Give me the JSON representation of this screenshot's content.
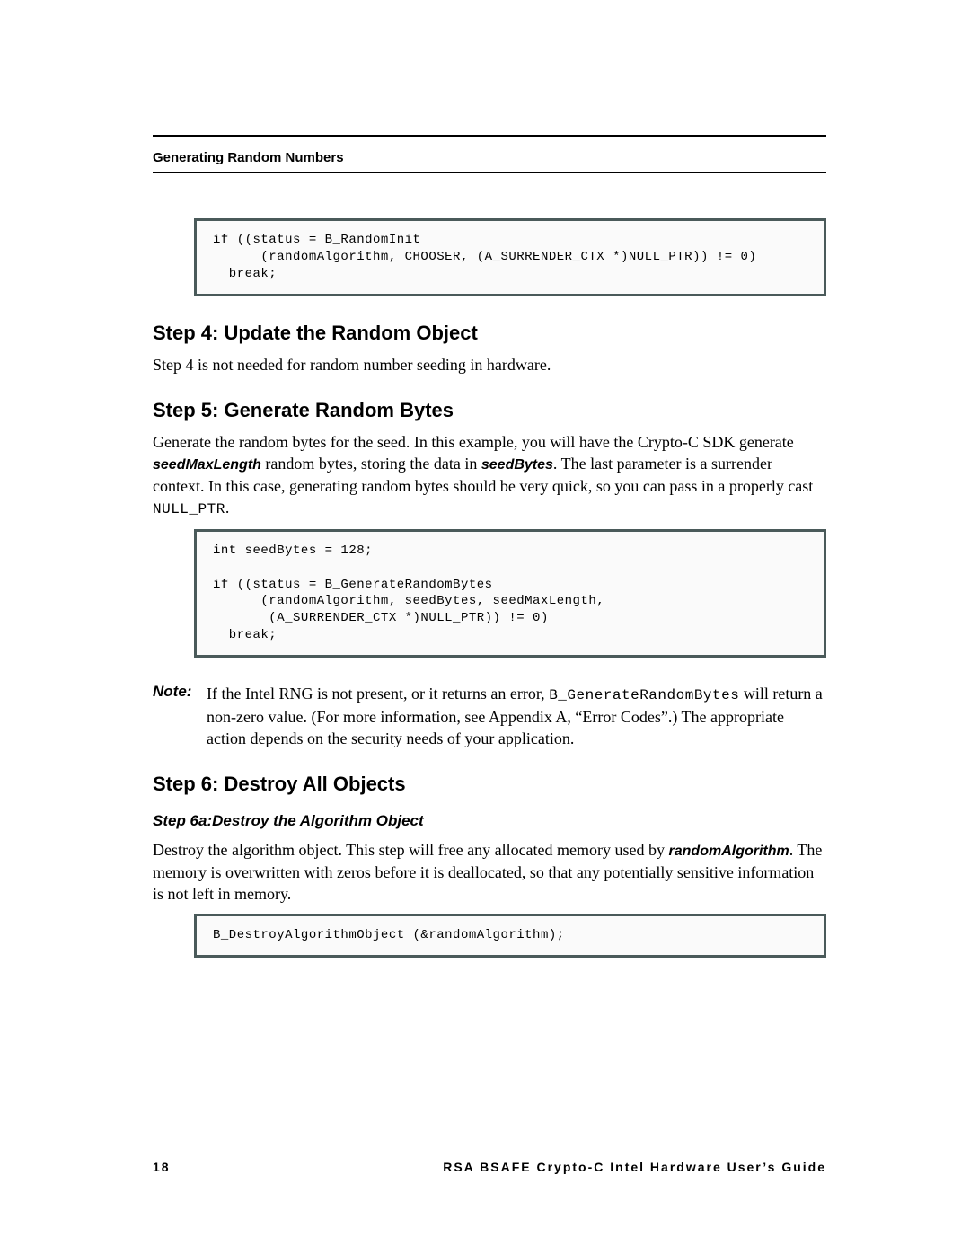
{
  "running_head": "Generating Random Numbers",
  "code1": "if ((status = B_RandomInit\n      (randomAlgorithm, CHOOSER, (A_SURRENDER_CTX *)NULL_PTR)) != 0)\n  break;",
  "step4": {
    "title": "Step 4: Update the Random Object",
    "para": "Step 4 is not needed for random number seeding in hardware."
  },
  "step5": {
    "title": "Step 5: Generate Random Bytes",
    "para_a": "Generate the random bytes for the seed. In this example, you will have the Crypto-C SDK generate ",
    "kw1": "seedMaxLength",
    "para_b": " random bytes, storing the data in ",
    "kw2": "seedBytes",
    "para_c": ". The last parameter is a surrender context. In this case, generating random bytes should be very quick, so you can pass in a properly cast ",
    "mono1": "NULL_PTR",
    "para_d": "."
  },
  "code2": "int seedBytes = 128;\n\nif ((status = B_GenerateRandomBytes\n      (randomAlgorithm, seedBytes, seedMaxLength,\n       (A_SURRENDER_CTX *)NULL_PTR)) != 0)\n  break;",
  "note": {
    "label": "Note:",
    "a": "If the Intel RNG is not present, or it returns an error, ",
    "mono": "B_GenerateRandomBytes",
    "b": " will return a non-zero value. (For more information, see Appendix A, “Error Codes”.) The appropriate action depends on the security needs of your application."
  },
  "step6": {
    "title": "Step 6: Destroy All Objects",
    "sub_title": "Step 6a:Destroy the Algorithm Object",
    "para_a": "Destroy the algorithm object. This step will free any allocated memory used by ",
    "kw": "randomAlgorithm",
    "para_b": ". The memory is overwritten with zeros before it is deallocated, so that any potentially sensitive information is not left in memory."
  },
  "code3": "B_DestroyAlgorithmObject (&randomAlgorithm);",
  "footer": {
    "page": "18",
    "doc": "RSA BSAFE Crypto-C Intel Hardware User’s Guide"
  }
}
